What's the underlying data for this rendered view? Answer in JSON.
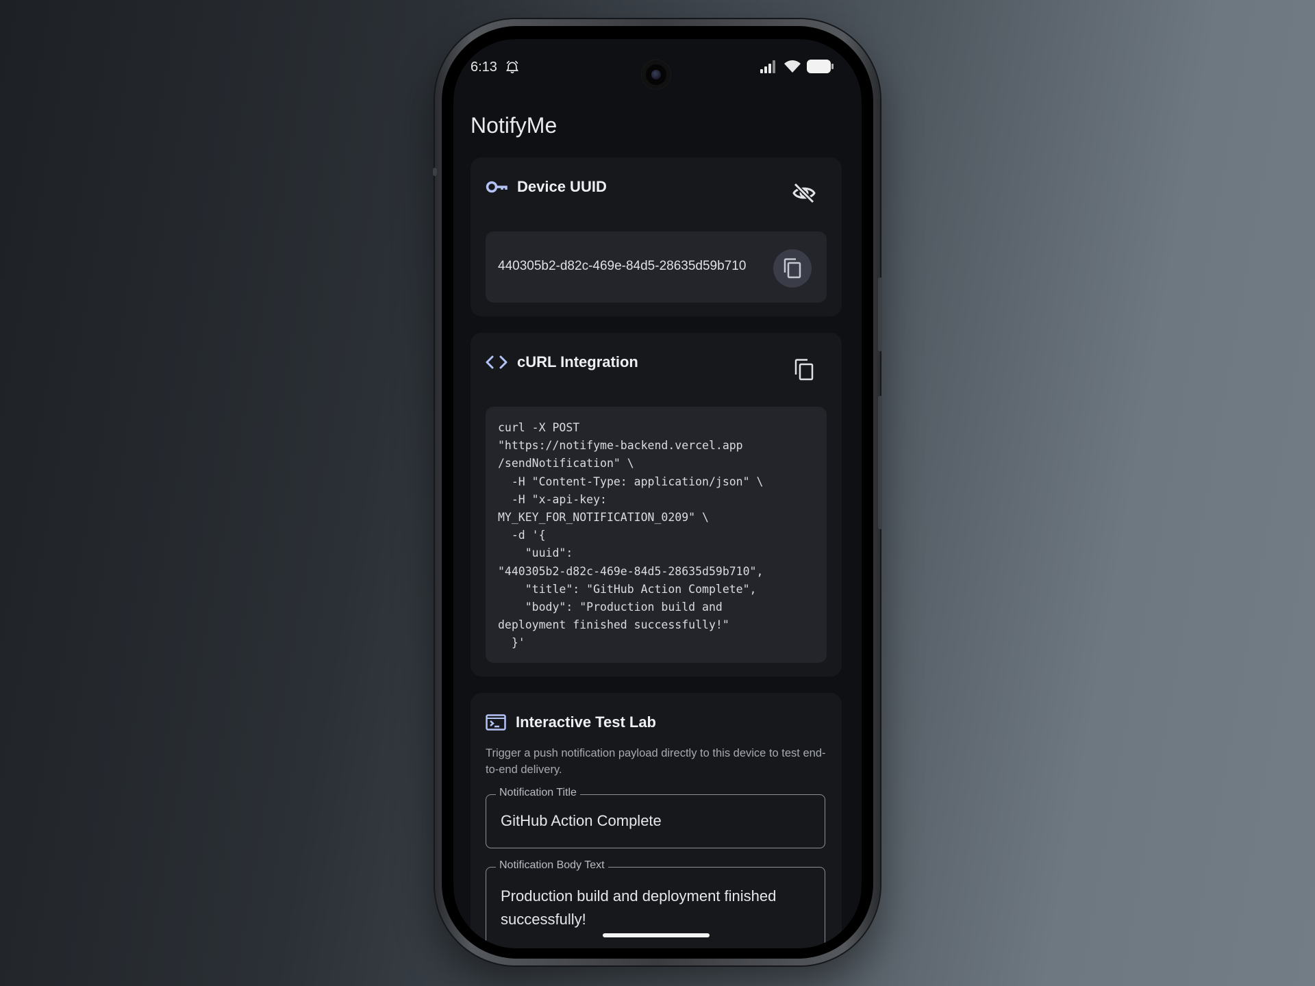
{
  "status_bar": {
    "time": "6:13",
    "icons": [
      "alarm-icon",
      "signal-icon",
      "wifi-icon",
      "battery-icon"
    ]
  },
  "app": {
    "title": "NotifyMe"
  },
  "device_card": {
    "heading": "Device UUID",
    "uuid": "440305b2-d82c-469e-84d5-28635d59b710",
    "icons": [
      "key-icon",
      "visibility-off-icon",
      "copy-icon"
    ]
  },
  "curl_card": {
    "heading": "cURL Integration",
    "code": "curl -X POST\n\"https://notifyme-backend.vercel.app\n/sendNotification\" \\\n  -H \"Content-Type: application/json\" \\\n  -H \"x-api-key:\nMY_KEY_FOR_NOTIFICATION_0209\" \\\n  -d '{\n    \"uuid\":\n\"440305b2-d82c-469e-84d5-28635d59b710\",\n    \"title\": \"GitHub Action Complete\",\n    \"body\": \"Production build and\ndeployment finished successfully!\"\n  }'",
    "icons": [
      "code-icon",
      "copy-icon"
    ]
  },
  "test_lab": {
    "heading": "Interactive Test Lab",
    "description": "Trigger a push notification payload directly to this device to test end-to-end delivery.",
    "title_field": {
      "label": "Notification Title",
      "value": "GitHub Action Complete"
    },
    "body_field": {
      "label": "Notification Body Text",
      "value": "Production build and deployment finished successfully!"
    },
    "icons": [
      "terminal-icon"
    ]
  },
  "colors": {
    "background": "#0f1013",
    "card": "#17181c",
    "inner": "#23252b",
    "accent_icon": "#b3c3f5",
    "text_primary": "#eef0f4"
  }
}
